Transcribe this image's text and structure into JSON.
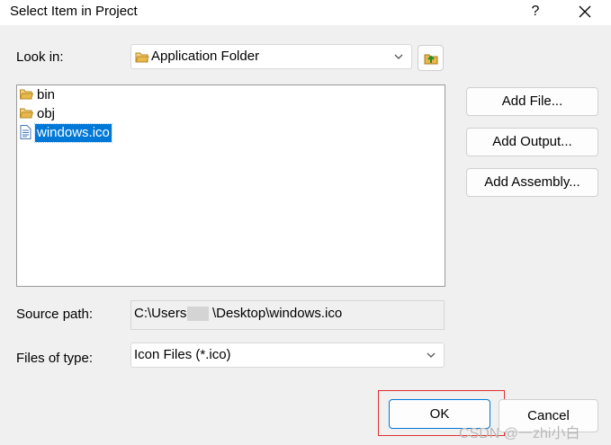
{
  "dialog": {
    "title": "Select Item in Project",
    "help_label": "?"
  },
  "look_in": {
    "label": "Look in:",
    "value": "Application Folder"
  },
  "file_list": {
    "items": [
      {
        "name": "bin",
        "icon": "folder-icon",
        "selected": false
      },
      {
        "name": "obj",
        "icon": "folder-icon",
        "selected": false
      },
      {
        "name": "windows.ico",
        "icon": "file-icon",
        "selected": true
      }
    ]
  },
  "buttons": {
    "add_file": "Add File...",
    "add_output": "Add Output...",
    "add_assembly": "Add Assembly...",
    "ok": "OK",
    "cancel": "Cancel"
  },
  "source_path": {
    "label": "Source path:",
    "prefix": "C:\\Users",
    "suffix": "\\Desktop\\windows.ico"
  },
  "files_of_type": {
    "label": "Files of type:",
    "value": "Icon Files (*.ico)"
  },
  "watermark": "CSDN @一zhi小白",
  "colors": {
    "selection": "#0078d7",
    "highlight_border": "#e03030",
    "folder": "#e8b84a"
  }
}
